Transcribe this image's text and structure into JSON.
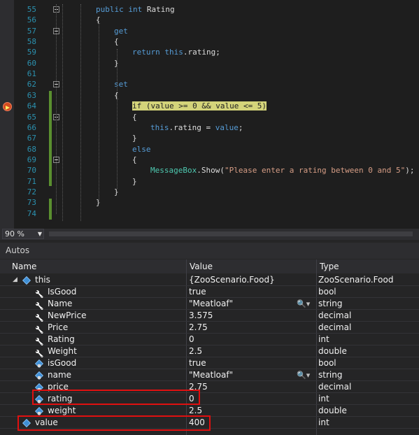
{
  "editor": {
    "lines": [
      {
        "num": "55",
        "segments": [
          {
            "t": "public int ",
            "c": "kw"
          },
          {
            "t": "Rating",
            "c": ""
          }
        ]
      },
      {
        "num": "56",
        "segments": [
          {
            "t": "{",
            "c": ""
          }
        ]
      },
      {
        "num": "57",
        "segments": [
          {
            "t": "get",
            "c": "kw"
          }
        ]
      },
      {
        "num": "58",
        "segments": [
          {
            "t": "{",
            "c": ""
          }
        ]
      },
      {
        "num": "59",
        "segments": [
          {
            "t": "return ",
            "c": "kw"
          },
          {
            "t": "this",
            "c": "kw"
          },
          {
            "t": ".rating;",
            "c": ""
          }
        ]
      },
      {
        "num": "60",
        "segments": [
          {
            "t": "}",
            "c": ""
          }
        ]
      },
      {
        "num": "61",
        "segments": []
      },
      {
        "num": "62",
        "segments": [
          {
            "t": "set",
            "c": "kw"
          }
        ]
      },
      {
        "num": "63",
        "segments": [
          {
            "t": "{",
            "c": ""
          }
        ]
      },
      {
        "num": "64",
        "segments": [
          {
            "t": "if (value >= 0 && value <= 5)",
            "c": "hl"
          }
        ]
      },
      {
        "num": "65",
        "segments": [
          {
            "t": "{",
            "c": ""
          }
        ]
      },
      {
        "num": "66",
        "segments": [
          {
            "t": "this",
            "c": "kw"
          },
          {
            "t": ".rating = ",
            "c": ""
          },
          {
            "t": "value",
            "c": "kw"
          },
          {
            "t": ";",
            "c": ""
          }
        ]
      },
      {
        "num": "67",
        "segments": [
          {
            "t": "}",
            "c": ""
          }
        ]
      },
      {
        "num": "68",
        "segments": [
          {
            "t": "else",
            "c": "kw"
          }
        ]
      },
      {
        "num": "69",
        "segments": [
          {
            "t": "{",
            "c": ""
          }
        ]
      },
      {
        "num": "70",
        "segments": [
          {
            "t": "MessageBox",
            "c": "cls"
          },
          {
            "t": ".Show(",
            "c": ""
          },
          {
            "t": "\"Please enter a rating between 0 and 5\"",
            "c": "str"
          },
          {
            "t": ");",
            "c": ""
          }
        ]
      },
      {
        "num": "71",
        "segments": [
          {
            "t": "}",
            "c": ""
          }
        ]
      },
      {
        "num": "72",
        "segments": [
          {
            "t": "}",
            "c": ""
          }
        ]
      },
      {
        "num": "73",
        "segments": [
          {
            "t": "}",
            "c": ""
          }
        ]
      },
      {
        "num": "74",
        "segments": []
      }
    ]
  },
  "zoom": {
    "value": "90 %",
    "icon": "chevron-down-icon"
  },
  "autos": {
    "title": "Autos",
    "columns": {
      "name": "Name",
      "value": "Value",
      "type": "Type"
    },
    "rows": [
      {
        "name": "this",
        "value": "{ZooScenario.Food}",
        "type": "ZooScenario.Food",
        "icon": "object-icon",
        "expander": "expanded"
      },
      {
        "name": "IsGood",
        "value": "true",
        "type": "bool",
        "icon": "wrench-property-icon"
      },
      {
        "name": "Name",
        "value": "\"Meatloaf\"",
        "type": "string",
        "icon": "wrench-property-icon",
        "visualizer": true
      },
      {
        "name": "NewPrice",
        "value": "3.575",
        "type": "decimal",
        "icon": "wrench-property-icon"
      },
      {
        "name": "Price",
        "value": "2.75",
        "type": "decimal",
        "icon": "wrench-property-icon"
      },
      {
        "name": "Rating",
        "value": "0",
        "type": "int",
        "icon": "wrench-property-icon"
      },
      {
        "name": "Weight",
        "value": "2.5",
        "type": "double",
        "icon": "wrench-property-icon"
      },
      {
        "name": "isGood",
        "value": "true",
        "type": "bool",
        "icon": "private-field-icon"
      },
      {
        "name": "name",
        "value": "\"Meatloaf\"",
        "type": "string",
        "icon": "private-field-icon",
        "visualizer": true
      },
      {
        "name": "price",
        "value": "2.75",
        "type": "decimal",
        "icon": "private-field-icon"
      },
      {
        "name": "rating",
        "value": "0",
        "type": "int",
        "icon": "private-field-icon",
        "highlighted": true
      },
      {
        "name": "weight",
        "value": "2.5",
        "type": "double",
        "icon": "private-field-icon"
      },
      {
        "name": "value",
        "value": "400",
        "type": "int",
        "icon": "local-variable-icon",
        "highlighted": true
      }
    ]
  },
  "colors": {
    "highlight_box": "#e01010",
    "current_line": "#d4d47a",
    "breakpoint": "#d44a1e"
  }
}
